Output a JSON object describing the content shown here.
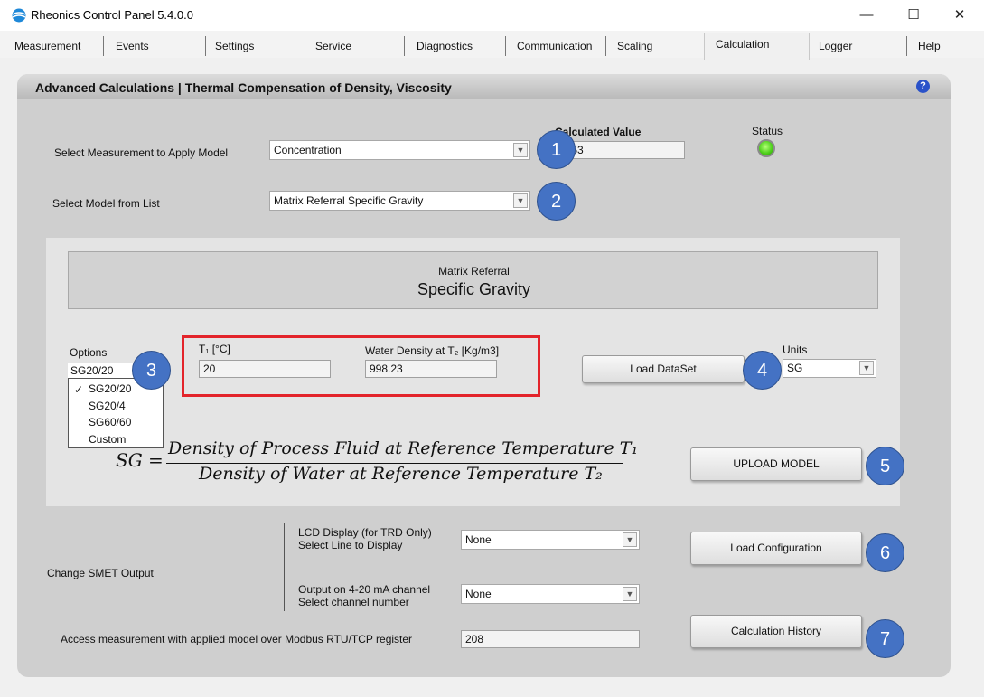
{
  "window": {
    "title": "Rheonics Control Panel 5.4.0.0",
    "minimize": "—",
    "maximize": "☐",
    "close": "✕"
  },
  "tabs": [
    {
      "label": "Measurement"
    },
    {
      "label": "Events"
    },
    {
      "label": "Settings"
    },
    {
      "label": "Service"
    },
    {
      "label": "Diagnostics"
    },
    {
      "label": "Communication"
    },
    {
      "label": "Scaling"
    },
    {
      "label": "Calculation",
      "active": true
    },
    {
      "label": "Logger"
    },
    {
      "label": "Help"
    }
  ],
  "panel": {
    "title": "Advanced Calculations | Thermal Compensation of Density, Viscosity",
    "help_icon": "?"
  },
  "measurement": {
    "label": "Select Measurement to Apply Model",
    "value": "Concentration"
  },
  "model": {
    "label": "Select Model from List",
    "value": "Matrix Referral Specific Gravity"
  },
  "calculated": {
    "label": "Calculated Value",
    "value": "7053"
  },
  "status": {
    "label": "Status",
    "color": "#4fd11c"
  },
  "model_header": {
    "subtitle": "Matrix Referral",
    "title": "Specific Gravity"
  },
  "options": {
    "label": "Options",
    "selected": "SG20/20",
    "items": [
      "SG20/20",
      "SG20/4",
      "SG60/60",
      "Custom"
    ],
    "check": "✓"
  },
  "t1": {
    "label": "T₁  [°C]",
    "value": "20"
  },
  "water_density": {
    "label": "Water Density at T₂  [Kg/m3]",
    "value": "998.23"
  },
  "buttons": {
    "load_dataset": "Load DataSet",
    "upload_model": "UPLOAD MODEL",
    "load_configuration": "Load Configuration",
    "calculation_history": "Calculation History"
  },
  "units": {
    "label": "Units",
    "value": "SG"
  },
  "formula": {
    "lhs": "SG =",
    "numerator": "Density of Process Fluid at Reference Temperature T₁",
    "denominator": "Density of Water at Reference Temperature T₂"
  },
  "smet": {
    "label": "Change SMET Output",
    "lcd_label_1": "LCD Display (for TRD Only)",
    "lcd_label_2": "Select Line to Display",
    "lcd_value": "None",
    "output_label_1": "Output on 4-20 mA channel",
    "output_label_2": "Select channel number",
    "output_value": "None"
  },
  "modbus": {
    "label": "Access measurement with applied model over Modbus RTU/TCP register",
    "value": "208"
  },
  "callouts": [
    "1",
    "2",
    "3",
    "4",
    "5",
    "6",
    "7"
  ],
  "colors": {
    "callout": "#4472c4",
    "highlight_box": "#e3242b",
    "panel": "#cfcfcf"
  }
}
